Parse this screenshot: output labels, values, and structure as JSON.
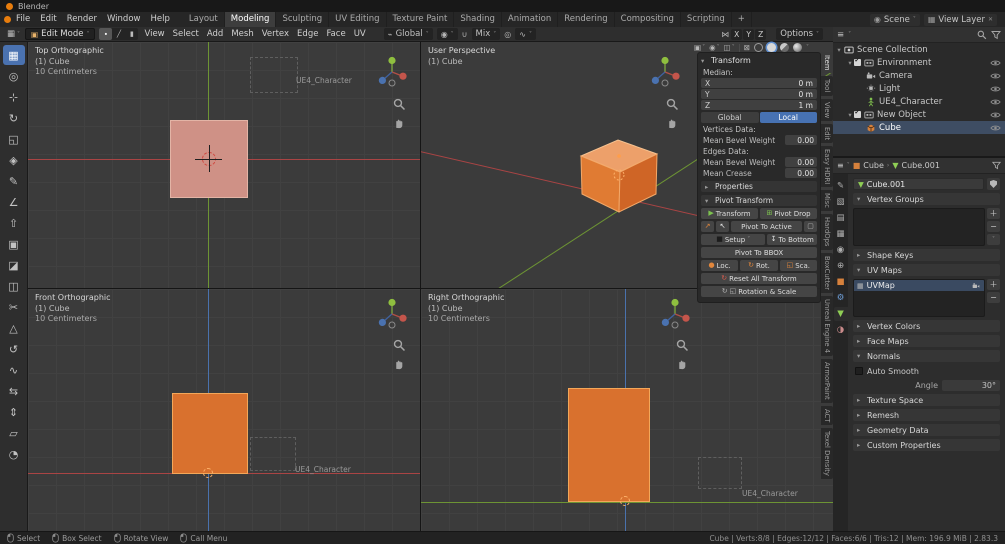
{
  "titlebar": {
    "title": "Blender"
  },
  "menubar": {
    "menus": [
      "File",
      "Edit",
      "Render",
      "Window",
      "Help"
    ],
    "workspaces": [
      {
        "label": "Layout"
      },
      {
        "label": "Modeling",
        "active": true
      },
      {
        "label": "Sculpting"
      },
      {
        "label": "UV Editing"
      },
      {
        "label": "Texture Paint"
      },
      {
        "label": "Shading"
      },
      {
        "label": "Animation"
      },
      {
        "label": "Rendering"
      },
      {
        "label": "Compositing"
      },
      {
        "label": "Scripting"
      },
      {
        "label": "+"
      }
    ],
    "scene": "Scene",
    "view_layer": "View Layer"
  },
  "toolheader": {
    "mode": "Edit Mode",
    "menus": [
      "View",
      "Select",
      "Add",
      "Mesh",
      "Vertex",
      "Edge",
      "Face",
      "UV"
    ],
    "orientation": "Global",
    "snap_with": "Mix",
    "mirror_axes": [
      "X",
      "Y",
      "Z"
    ],
    "options": "Options"
  },
  "toolbar": {
    "tools": [
      {
        "icon": "select-box",
        "active": true
      },
      {
        "icon": "cursor"
      },
      {
        "icon": "move"
      },
      {
        "icon": "rotate"
      },
      {
        "icon": "scale"
      },
      {
        "icon": "transform"
      },
      {
        "icon": "annotate"
      },
      {
        "icon": "measure"
      },
      {
        "icon": "extrude"
      },
      {
        "icon": "inset"
      },
      {
        "icon": "bevel"
      },
      {
        "icon": "loop-cut"
      },
      {
        "icon": "knife"
      },
      {
        "icon": "poly-build"
      },
      {
        "icon": "spin"
      },
      {
        "icon": "smooth"
      },
      {
        "icon": "edge-slide"
      },
      {
        "icon": "shrink-fatten"
      },
      {
        "icon": "shear"
      },
      {
        "icon": "rip-region"
      }
    ]
  },
  "viewports": {
    "top_left": {
      "view": "Top Orthographic",
      "object": "(1) Cube",
      "unit": "10 Centimeters",
      "annotation": "UE4_Character"
    },
    "top_right": {
      "view": "User Perspective",
      "object": "(1) Cube"
    },
    "bottom_left": {
      "view": "Front Orthographic",
      "object": "(1) Cube",
      "unit": "10 Centimeters",
      "annotation": "UE4_Character"
    },
    "bottom_right": {
      "view": "Right Orthographic",
      "object": "(1) Cube",
      "unit": "10 Centimeters",
      "annotation": "UE4_Character"
    }
  },
  "npanel": {
    "title": "Transform",
    "median_label": "Median:",
    "median": [
      {
        "axis": "X",
        "value": "0 m"
      },
      {
        "axis": "Y",
        "value": "0 m"
      },
      {
        "axis": "Z",
        "value": "1 m"
      }
    ],
    "space": [
      {
        "label": "Global"
      },
      {
        "label": "Local",
        "active": true
      }
    ],
    "vertices_label": "Vertices Data:",
    "vertex_rows": [
      {
        "label": "Mean Bevel Weight",
        "value": "0.00"
      }
    ],
    "edges_label": "Edges Data:",
    "edge_rows": [
      {
        "label": "Mean Bevel Weight",
        "value": "0.00"
      },
      {
        "label": "Mean Crease",
        "value": "0.00"
      }
    ],
    "properties_section": "Properties",
    "pivot_section": "Pivot Transform",
    "pivot": {
      "transform": "Transform",
      "pivot_drop": "Pivot Drop",
      "pivot_to_active": "Pivot To Active",
      "setup": "Setup",
      "to_bottom": "To Bottom",
      "pivot_to_bbox": "Pivot To BBOX",
      "loc": "Loc.",
      "rot": "Rot.",
      "sca": "Sca.",
      "reset_all": "Reset All Transform",
      "rotation_scale": "Rotation & Scale"
    }
  },
  "side_tabs": [
    {
      "label": "Item",
      "active": true
    },
    {
      "label": "Tool"
    },
    {
      "label": "View"
    },
    {
      "label": "Edit"
    },
    {
      "label": "Easy HDRI"
    },
    {
      "label": "Misc"
    },
    {
      "label": "HardOps"
    },
    {
      "label": "BoxCutter"
    },
    {
      "label": "Unreal Engine 4"
    },
    {
      "label": "ArmorPaint"
    },
    {
      "label": "ACT"
    },
    {
      "label": "Texel Density"
    }
  ],
  "outliner": {
    "rows": [
      {
        "label": "Scene Collection",
        "depth": 0,
        "icon": "scene-collection",
        "caret": true
      },
      {
        "label": "Environment",
        "depth": 1,
        "icon": "collection",
        "caret": true,
        "checkbox": true,
        "eye": true
      },
      {
        "label": "Camera",
        "depth": 2,
        "icon": "camera",
        "eye": true
      },
      {
        "label": "Light",
        "depth": 2,
        "icon": "light",
        "eye": true
      },
      {
        "label": "UE4_Character",
        "depth": 2,
        "icon": "armature",
        "eye": true
      },
      {
        "label": "New Object",
        "depth": 1,
        "icon": "collection",
        "caret": true,
        "checkbox": true,
        "eye": true
      },
      {
        "label": "Cube",
        "depth": 2,
        "icon": "mesh",
        "selected": true,
        "eye": true
      }
    ]
  },
  "properties": {
    "breadcrumb": {
      "object": "Cube",
      "data": "Cube.001"
    },
    "name_value": "Cube.001",
    "tabs": [
      {
        "icon": "ptool"
      },
      {
        "icon": "prender"
      },
      {
        "icon": "poutput"
      },
      {
        "icon": "pviewlayer"
      },
      {
        "icon": "pscene"
      },
      {
        "icon": "pworld"
      },
      {
        "icon": "pobject"
      },
      {
        "icon": "pmod"
      },
      {
        "icon": "pdata",
        "active": true
      },
      {
        "icon": "pmat"
      }
    ],
    "sections": {
      "vertex_groups": {
        "title": "Vertex Groups"
      },
      "shape_keys": {
        "title": "Shape Keys"
      },
      "uv_maps": {
        "title": "UV Maps",
        "active_item": "UVMap"
      },
      "vertex_colors": {
        "title": "Vertex Colors"
      },
      "face_maps": {
        "title": "Face Maps"
      },
      "normals": {
        "title": "Normals",
        "auto_smooth": "Auto Smooth",
        "angle_label": "Angle",
        "angle_value": "30°"
      },
      "texture_space": {
        "title": "Texture Space"
      },
      "remesh": {
        "title": "Remesh"
      },
      "geometry_data": {
        "title": "Geometry Data"
      },
      "custom_properties": {
        "title": "Custom Properties"
      }
    }
  },
  "statusbar": {
    "hints": [
      {
        "label": "Select",
        "icon": "mouse-left"
      },
      {
        "label": "Box Select",
        "icon": "mouse-drag"
      },
      {
        "label": "Rotate View",
        "icon": "mouse-middle"
      },
      {
        "label": "Call Menu",
        "icon": "mouse-right"
      }
    ],
    "stats": [
      "Cube",
      "Verts:8/8",
      "Edges:12/12",
      "Faces:6/6",
      "Tris:12",
      "Mem: 196.9 MiB",
      "2.83.3"
    ]
  },
  "colors": {
    "accent_blue": "#4772b3",
    "object_orange": "#d9712e",
    "selected_face_pink": "#cf9186",
    "axis_red": "#aa4444",
    "axis_green": "#6d9434",
    "axis_blue": "#4a72ad"
  }
}
